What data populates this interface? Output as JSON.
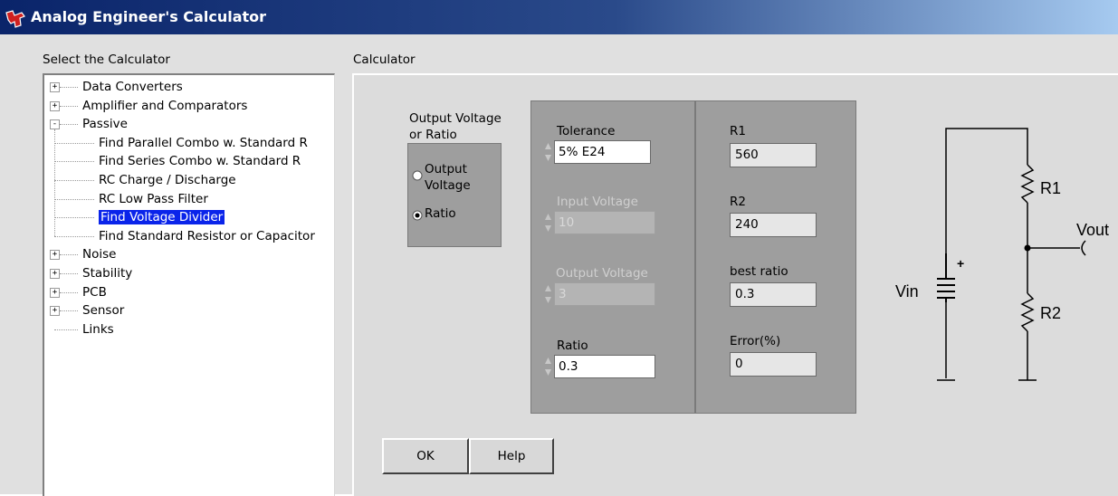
{
  "window": {
    "title": "Analog Engineer's Calculator"
  },
  "selector": {
    "label": "Select the Calculator",
    "tree": [
      {
        "label": "Data Converters",
        "level": 0,
        "expander": "+"
      },
      {
        "label": "Amplifier and Comparators",
        "level": 0,
        "expander": "+"
      },
      {
        "label": "Passive",
        "level": 0,
        "expander": "-"
      },
      {
        "label": "Find Parallel Combo w. Standard R",
        "level": 1
      },
      {
        "label": "Find Series Combo w. Standard R",
        "level": 1
      },
      {
        "label": "RC Charge / Discharge",
        "level": 1
      },
      {
        "label": "RC Low Pass Filter",
        "level": 1
      },
      {
        "label": "Find Voltage Divider",
        "level": 1,
        "selected": true
      },
      {
        "label": "Find Standard Resistor or Capacitor",
        "level": 1
      },
      {
        "label": "Noise",
        "level": 0,
        "expander": "+"
      },
      {
        "label": "Stability",
        "level": 0,
        "expander": "+"
      },
      {
        "label": "PCB",
        "level": 0,
        "expander": "+"
      },
      {
        "label": "Sensor",
        "level": 0,
        "expander": "+"
      },
      {
        "label": "Links",
        "level": 0
      }
    ]
  },
  "calculator": {
    "label": "Calculator",
    "mode": {
      "label_line1": "Output Voltage",
      "label_line2": "or Ratio",
      "option_output_line1": "Output",
      "option_output_line2": "Voltage",
      "option_ratio": "Ratio",
      "selected": "Ratio"
    },
    "inputs": {
      "tolerance_label": "Tolerance",
      "tolerance_value": "5% E24",
      "input_voltage_label": "Input Voltage",
      "input_voltage_value": "10",
      "output_voltage_label": "Output Voltage",
      "output_voltage_value": "3",
      "ratio_label": "Ratio",
      "ratio_value": "0.3"
    },
    "outputs": {
      "r1_label": "R1",
      "r1_value": "560",
      "r2_label": "R2",
      "r2_value": "240",
      "best_ratio_label": "best ratio",
      "best_ratio_value": "0.3",
      "error_label": "Error(%)",
      "error_value": "0"
    },
    "schematic": {
      "r1": "R1",
      "r2": "R2",
      "vout": "Vout",
      "vin": "Vin",
      "plus": "+"
    },
    "buttons": {
      "ok": "OK",
      "help": "Help"
    }
  },
  "colors": {
    "titlebar": "#0a246a",
    "selection": "#0a24ea",
    "panel_grey": "#9e9e9e"
  }
}
